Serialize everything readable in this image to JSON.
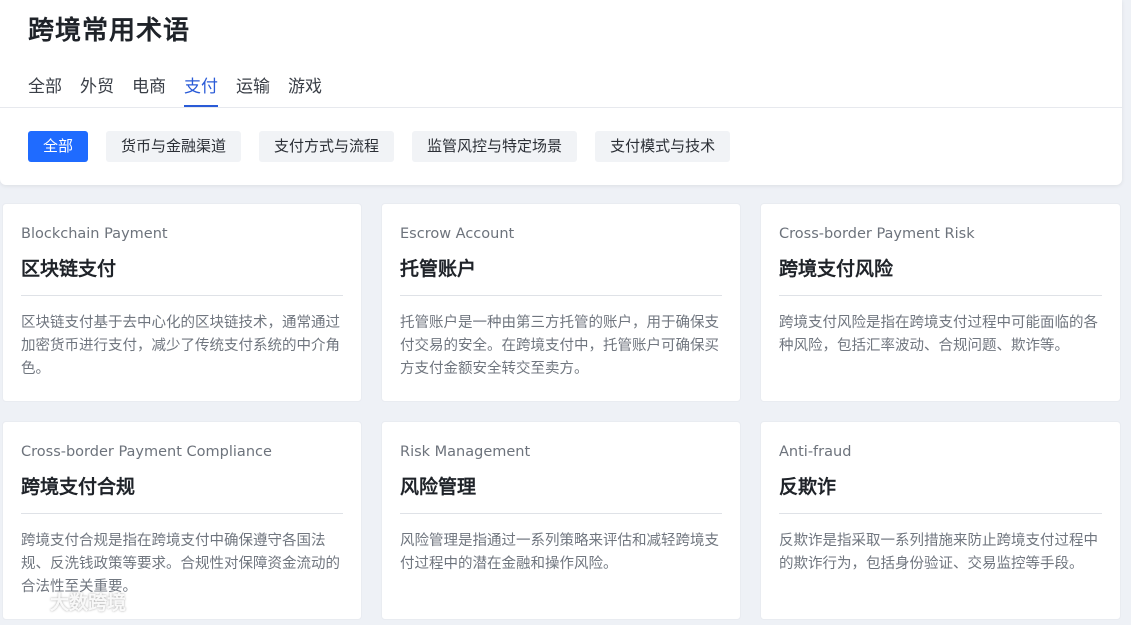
{
  "page": {
    "title": "跨境常用术语"
  },
  "tabs": [
    {
      "label": "全部",
      "active": false
    },
    {
      "label": "外贸",
      "active": false
    },
    {
      "label": "电商",
      "active": false
    },
    {
      "label": "支付",
      "active": true
    },
    {
      "label": "运输",
      "active": false
    },
    {
      "label": "游戏",
      "active": false
    }
  ],
  "filters": [
    {
      "label": "全部",
      "active": true
    },
    {
      "label": "货币与金融渠道",
      "active": false
    },
    {
      "label": "支付方式与流程",
      "active": false
    },
    {
      "label": "监管风控与特定场景",
      "active": false
    },
    {
      "label": "支付模式与技术",
      "active": false
    }
  ],
  "cards": [
    {
      "en": "Blockchain Payment",
      "zh": "区块链支付",
      "desc": "区块链支付基于去中心化的区块链技术，通常通过加密货币进行支付，减少了传统支付系统的中介角色。"
    },
    {
      "en": "Escrow Account",
      "zh": "托管账户",
      "desc": "托管账户是一种由第三方托管的账户，用于确保支付交易的安全。在跨境支付中，托管账户可确保买方支付金额安全转交至卖方。"
    },
    {
      "en": "Cross-border Payment Risk",
      "zh": "跨境支付风险",
      "desc": "跨境支付风险是指在跨境支付过程中可能面临的各种风险，包括汇率波动、合规问题、欺诈等。"
    },
    {
      "en": "Cross-border Payment Compliance",
      "zh": "跨境支付合规",
      "desc": "跨境支付合规是指在跨境支付中确保遵守各国法规、反洗钱政策等要求。合规性对保障资金流动的合法性至关重要。"
    },
    {
      "en": "Risk Management",
      "zh": "风险管理",
      "desc": "风险管理是指通过一系列策略来评估和减轻跨境支付过程中的潜在金融和操作风险。"
    },
    {
      "en": "Anti-fraud",
      "zh": "反欺诈",
      "desc": "反欺诈是指采取一系列措施来防止跨境支付过程中的欺诈行为，包括身份验证、交易监控等手段。"
    }
  ],
  "watermark": {
    "text": "大数跨境",
    "icon": "brand-logo-icon"
  },
  "colors": {
    "accent": "#1f6bff",
    "tab_active": "#2a5bd7",
    "background": "#eef1f6"
  }
}
